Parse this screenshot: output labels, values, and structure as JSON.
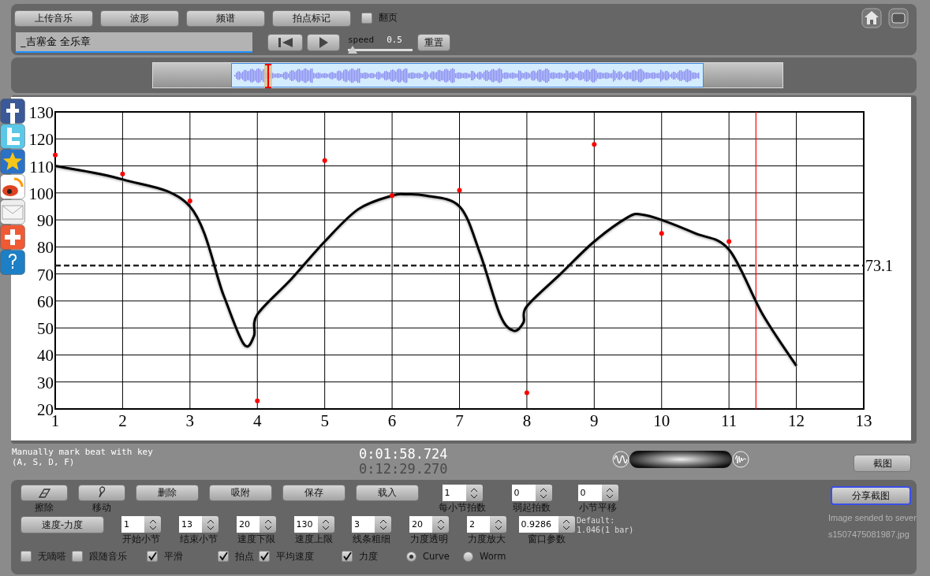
{
  "toolbar": {
    "buttons": [
      "上传音乐",
      "波形",
      "频谱",
      "拍点标记"
    ],
    "page_turn": {
      "label": "翻页",
      "checked": false
    }
  },
  "title_field": {
    "value": "_吉塞金 全乐章"
  },
  "speed": {
    "label": "speed",
    "value": "0.5",
    "level": 0,
    "reset_button": "重置"
  },
  "chart": {
    "chart_data": {
      "type": "line",
      "x": [
        1,
        2,
        3,
        3.5,
        3.8,
        3.95,
        4,
        4.5,
        5,
        5.5,
        6,
        6.2,
        6.5,
        7,
        7.3,
        7.6,
        7.8,
        7.95,
        8,
        8.5,
        9,
        9.5,
        9.7,
        10,
        10.5,
        11,
        11.5,
        12
      ],
      "series": [
        {
          "type": "line",
          "color": "#000000",
          "values": [
            110,
            105,
            95,
            62,
            44,
            47,
            55,
            68,
            82,
            94,
            99,
            99.5,
            99,
            95,
            78,
            55,
            49,
            52,
            58,
            70,
            82,
            91,
            92,
            90,
            85,
            79,
            55,
            36
          ]
        },
        {
          "type": "scatter",
          "color": "#ff0000",
          "values": [
            114,
            107,
            97,
            null,
            null,
            null,
            23,
            null,
            112,
            null,
            99,
            null,
            null,
            101,
            null,
            null,
            null,
            null,
            26,
            null,
            118,
            null,
            null,
            85,
            null,
            82,
            null,
            null
          ]
        }
      ],
      "xlim": [
        1,
        13
      ],
      "ylim": [
        20,
        130
      ],
      "xticks": [
        1,
        2,
        3,
        4,
        5,
        6,
        7,
        8,
        9,
        10,
        11,
        12,
        13
      ],
      "yticks": [
        20,
        30,
        40,
        50,
        60,
        70,
        80,
        90,
        100,
        110,
        120,
        130
      ],
      "grid": true,
      "ref_lines": [
        {
          "axis": "y",
          "value": 73.1,
          "label": "73.1",
          "color": "#222222"
        },
        {
          "axis": "x",
          "value": 11.4,
          "color": "#ff0000"
        }
      ]
    }
  },
  "hint_lines": [
    "Manually mark beat with key",
    "(A, S, D, F)"
  ],
  "times": [
    "0:01:58.724",
    "0:12:29.270"
  ],
  "screenshot_button": "截图",
  "tools": [
    {
      "kind": "eraser",
      "label": "擦除"
    },
    {
      "kind": "brush",
      "label": "移动"
    }
  ],
  "action_buttons": [
    "删除",
    "吸附",
    "保存",
    "载入"
  ],
  "spinners_top": [
    {
      "value": "1",
      "label": "每小节拍数"
    },
    {
      "value": "0",
      "label": "弱起拍数"
    },
    {
      "value": "0",
      "label": "小节平移"
    }
  ],
  "mode_button": "速度-力度",
  "spinners_bottom": [
    {
      "value": "1",
      "label": "开始小节"
    },
    {
      "value": "13",
      "label": "结束小节"
    },
    {
      "value": "20",
      "label": "速度下限"
    },
    {
      "value": "130",
      "label": "速度上限"
    },
    {
      "value": "3",
      "label": "线条粗细"
    },
    {
      "value": "20",
      "label": "力度透明"
    },
    {
      "value": "2",
      "label": "力度放大"
    },
    {
      "value": "0.9286",
      "label": "窗口参数"
    }
  ],
  "default_note": [
    "Default:",
    "1.046(1 bar)"
  ],
  "checkboxes": [
    {
      "label": "无嘀嗒",
      "checked": false
    },
    {
      "label": "跟随音乐",
      "checked": false
    },
    {
      "label": "平滑",
      "checked": true
    },
    {
      "label": "拍点",
      "checked": true
    },
    {
      "label": "平均速度",
      "checked": true
    },
    {
      "label": "力度",
      "checked": true
    }
  ],
  "radios": [
    {
      "label": "Curve",
      "selected": true
    },
    {
      "label": "Worm",
      "selected": false
    }
  ],
  "share_button": "分享截图",
  "upload_status": [
    "Image sended to sever",
    "s1507475081987.jpg"
  ]
}
